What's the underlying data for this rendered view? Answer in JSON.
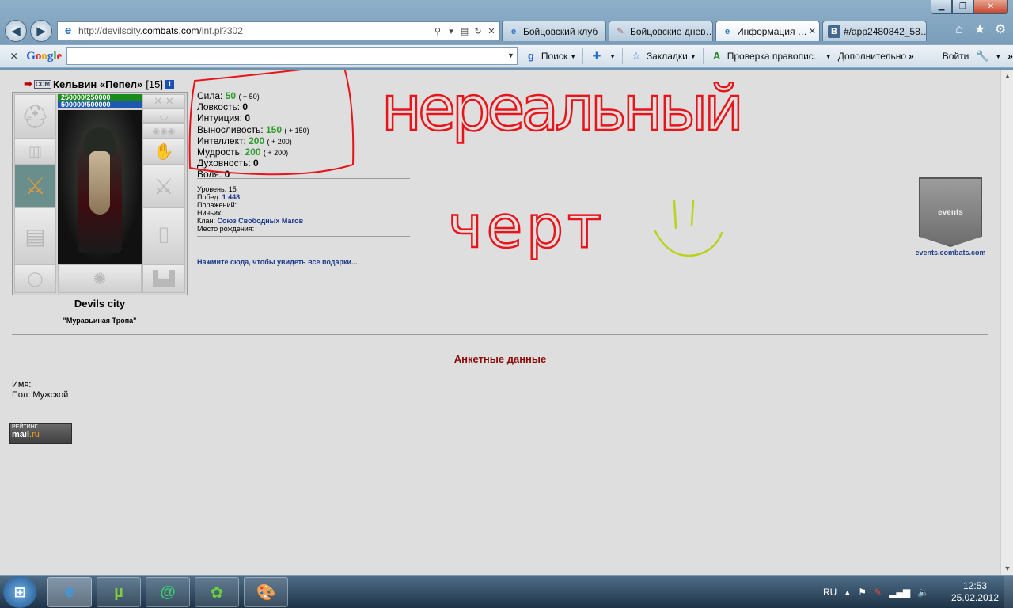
{
  "browser": {
    "url_prefix": "http://devilscity.",
    "url_domain": "combats.com",
    "url_path": "/inf.pl?302",
    "tabs": [
      {
        "label": "Бойцовский клуб",
        "icon": "ie-icon",
        "active": false
      },
      {
        "label": "Бойцовские днев…",
        "icon": "book-icon",
        "active": false
      },
      {
        "label": "Информация …",
        "icon": "ie-icon",
        "active": true
      },
      {
        "label": "#/app2480842_58…",
        "icon": "vk-icon",
        "active": false
      }
    ]
  },
  "google_toolbar": {
    "logo": "Google",
    "search_value": "",
    "search_label": "Поиск",
    "bookmarks_label": "Закладки",
    "spellcheck_label": "Проверка правопис…",
    "more_label": "Дополнительно",
    "signin_label": "Войти"
  },
  "character": {
    "name": "Кельвин «Пепел»",
    "level": "[15]",
    "hp": "250000/250000",
    "mp": "500000/500000",
    "city": "Devils city",
    "location": "\"Муравьиная Тропа\"",
    "stats": [
      {
        "label": "Сила:",
        "value": "50",
        "bonus": "( + 50)",
        "boosted": true
      },
      {
        "label": "Ловкость:",
        "value": "0",
        "bonus": "",
        "boosted": false
      },
      {
        "label": "Интуиция:",
        "value": "0",
        "bonus": "",
        "boosted": false
      },
      {
        "label": "Выносливость:",
        "value": "150",
        "bonus": "( + 150)",
        "boosted": true
      },
      {
        "label": "Интеллект:",
        "value": "200",
        "bonus": "( + 200)",
        "boosted": true
      },
      {
        "label": "Мудрость:",
        "value": "200",
        "bonus": "( + 200)",
        "boosted": true
      },
      {
        "label": "Духовность:",
        "value": "0",
        "bonus": "",
        "boosted": false
      },
      {
        "label": "Воля:",
        "value": "0",
        "bonus": "",
        "boosted": false
      }
    ],
    "info": {
      "level_label": "Уровень:",
      "level_value": "15",
      "wins_label": "Побед:",
      "wins_value": "1 448",
      "losses_label": "Поражений:",
      "draws_label": "Ничьих:",
      "clan_label": "Клан:",
      "clan_value": "Союз Свободных Магов",
      "birthplace_label": "Место рождения:"
    },
    "gifts_link": "Нажмите сюда, чтобы увидеть все подарки..."
  },
  "events_caption": "events.combats.com",
  "events_banner_text": "events",
  "anketa": {
    "title": "Анкетные данные",
    "name_label": "Имя:",
    "gender_label": "Пол:",
    "gender_value": "Мужской"
  },
  "rating_badge": {
    "top": "РЕЙТИНГ",
    "mail": "mail",
    "ru": ".ru"
  },
  "handwriting": {
    "line1": "нереальный",
    "line2": "черт"
  },
  "taskbar": {
    "lang": "RU",
    "time": "12:53",
    "date": "25.02.2012"
  }
}
